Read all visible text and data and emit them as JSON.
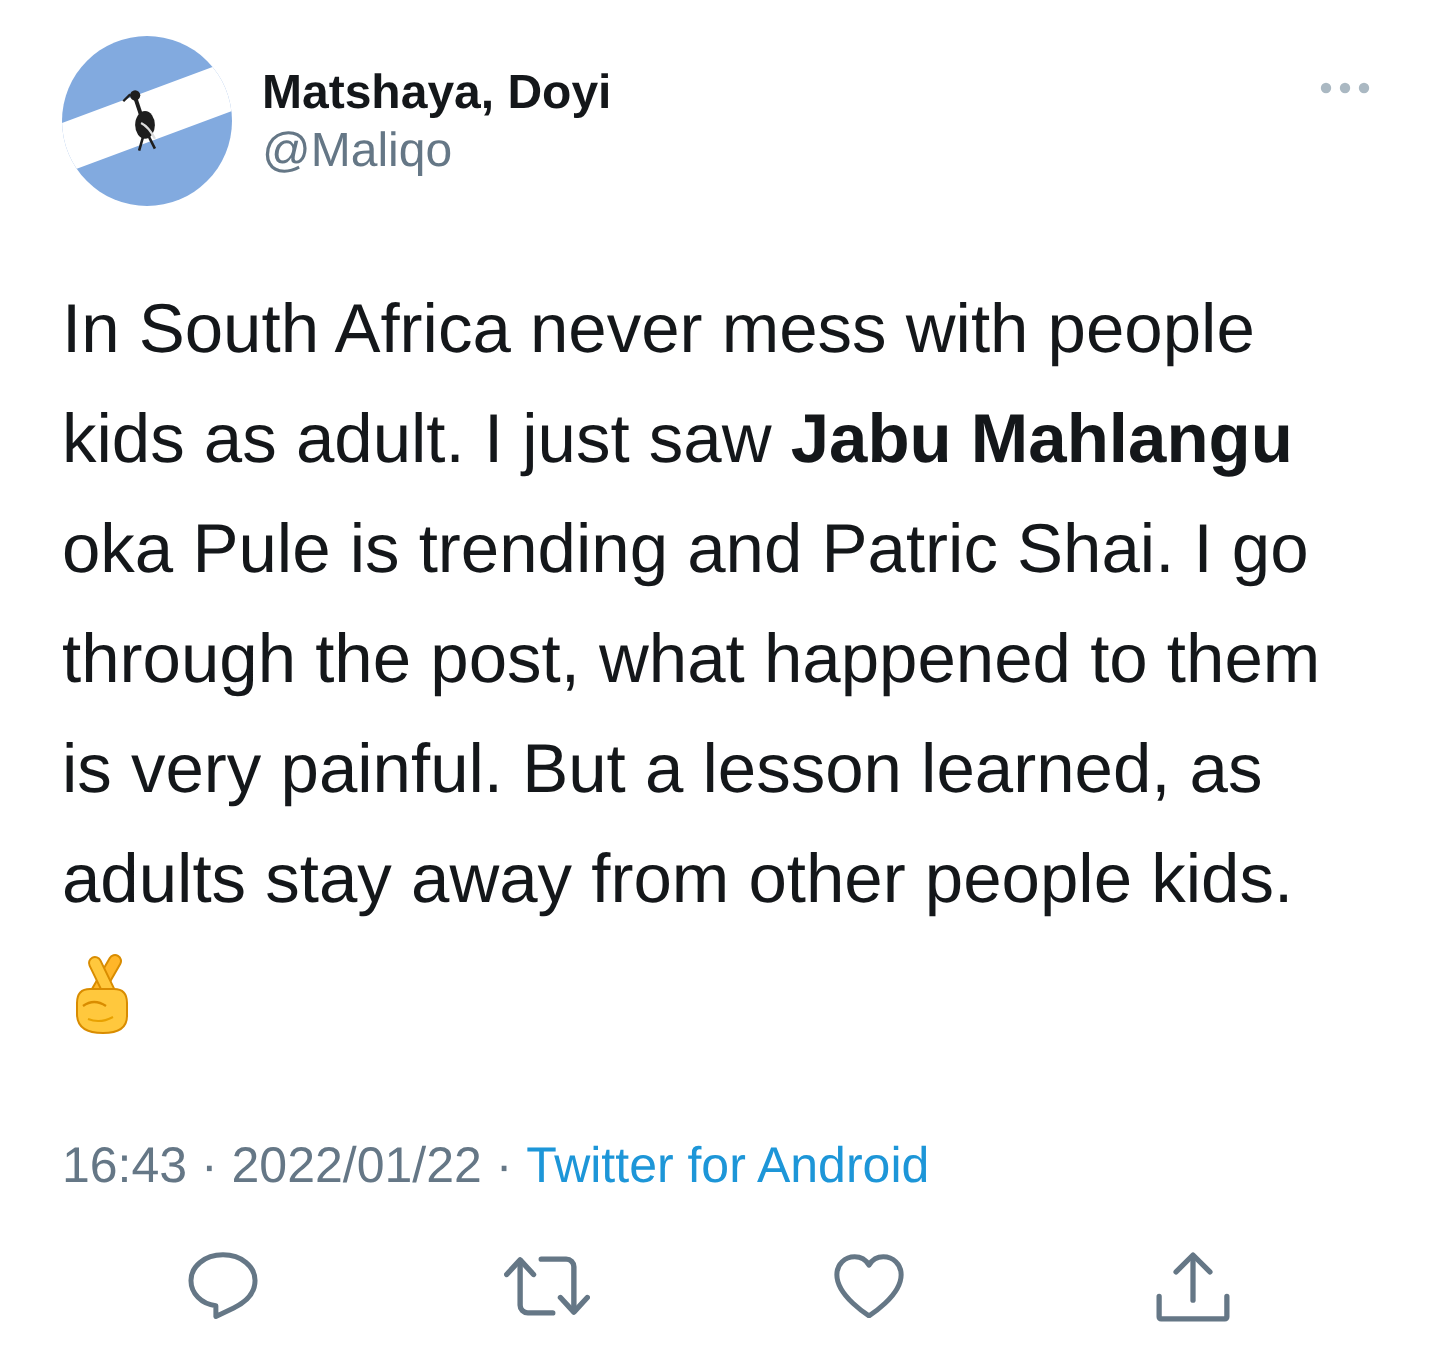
{
  "author": {
    "name": "Matshaya, Doyi",
    "handle": "@Maliqo"
  },
  "tweet": {
    "text": "In South Africa never mess with people kids as adult. I just saw **Jabu Mahlangu** oka Pule is trending and Patric Shai. I go through the post, what happened to them is very painful. But a lesson learned, as adults stay away from other people kids."
  },
  "meta": {
    "timestamp": "16:43 · 2022/01/22 ·",
    "source": "Twitter for Android"
  }
}
